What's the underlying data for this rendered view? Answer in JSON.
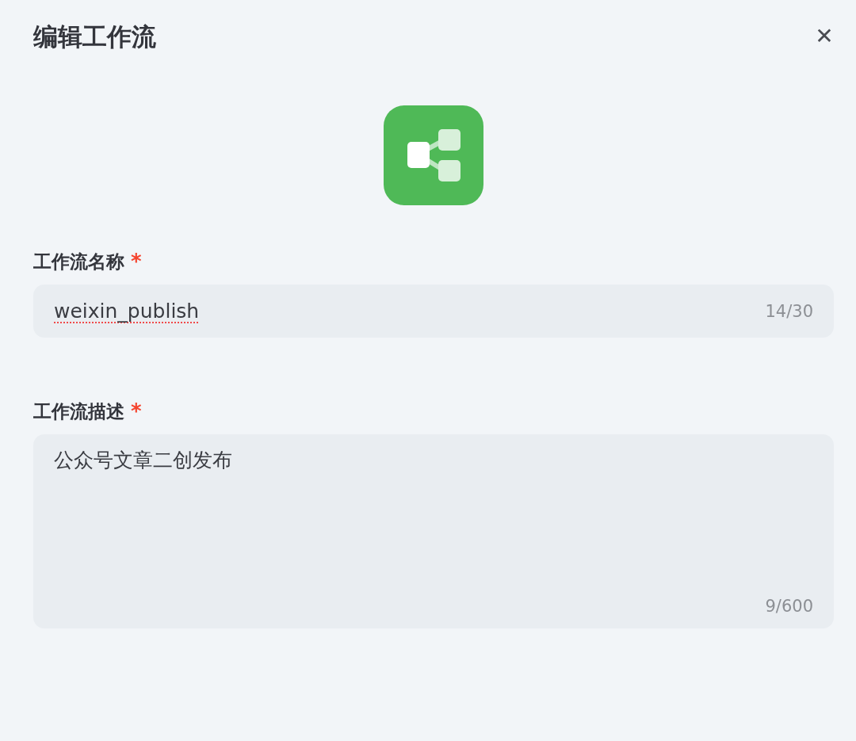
{
  "dialog": {
    "title": "编辑工作流",
    "close_label": "✕"
  },
  "fields": [
    {
      "kind": "input",
      "label": "工作流名称",
      "required_mark": "*",
      "value": "weixin_publish",
      "spell_error": true,
      "counter": "14/30"
    },
    {
      "kind": "textarea",
      "label": "工作流描述",
      "required_mark": "*",
      "value": "公众号文章二创发布",
      "spell_error": false,
      "counter": "9/600"
    }
  ]
}
